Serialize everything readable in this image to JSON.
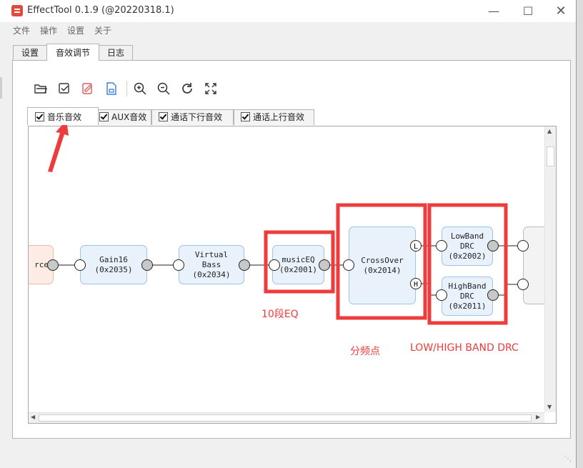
{
  "window": {
    "title": "EffectTool 0.1.9  (@20220318.1)"
  },
  "menu": [
    "文件",
    "操作",
    "设置",
    "关于"
  ],
  "tabs": [
    "设置",
    "音效调节",
    "日志"
  ],
  "subtabs": [
    "音乐音效",
    "AUX音效",
    "通话下行音效",
    "通话上行音效"
  ],
  "toolbar": [
    "open-folder-icon",
    "check-icon",
    "edit-icon",
    "save-file-icon",
    "zoom-in-icon",
    "zoom-out-icon",
    "refresh-icon",
    "fit-screen-icon"
  ],
  "flow": {
    "source_label": "rce",
    "nodes": [
      {
        "name": "Gain16",
        "id": "(0x2035)"
      },
      {
        "name": "Virtual\nBass",
        "id": "(0x2034)"
      },
      {
        "name": "musicEQ",
        "id": "(0x2001)"
      },
      {
        "name": "CrossOver",
        "id": "(0x2014)"
      },
      {
        "name": "LowBand\nDRC",
        "id": "(0x2002)"
      },
      {
        "name": "HighBand\nDRC",
        "id": "(0x2011)"
      }
    ],
    "port_low": "L",
    "port_high": "H"
  },
  "annotations": {
    "eq": "10段EQ",
    "crossover": "分频点",
    "drc": "LOW/HIGH BAND DRC"
  },
  "colors": {
    "highlight": "#ee3b3b",
    "node_fill": "#e9f2fb",
    "node_border": "#9cc3e8",
    "port_fill": "#c8c8c8",
    "source_fill": "#fdece6"
  }
}
